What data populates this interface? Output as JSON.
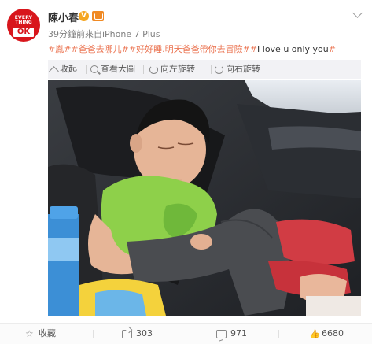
{
  "post": {
    "avatar": {
      "line1": "EVERY",
      "line2": "THING",
      "line3": "OK"
    },
    "username": "陳小春",
    "badge_v": "V",
    "meta": "39分鐘前來自iPhone 7 Plus",
    "content": {
      "hashtags_1": "#胤##爸爸去哪儿##好好睡.明天爸爸帶你去冒險##",
      "plain": "I love u only you",
      "hashtag_end": "#"
    }
  },
  "toolbar": {
    "collapse": "收起",
    "view_large": "查看大圖",
    "rotate_left": "向左旋转",
    "rotate_right": "向右旋转"
  },
  "footer": {
    "favorite": "收藏",
    "repost_count": "303",
    "comment_count": "971",
    "like_count": "6680"
  },
  "colors": {
    "accent": "#eb7350",
    "avatar_red": "#d8161c",
    "toolbar_bg": "#f2f2f5"
  },
  "icons": [
    "chevron-down-icon",
    "collapse-icon",
    "magnifier-icon",
    "rotate-left-icon",
    "rotate-right-icon",
    "star-icon",
    "repost-icon",
    "comment-icon",
    "thumbs-up-icon"
  ]
}
